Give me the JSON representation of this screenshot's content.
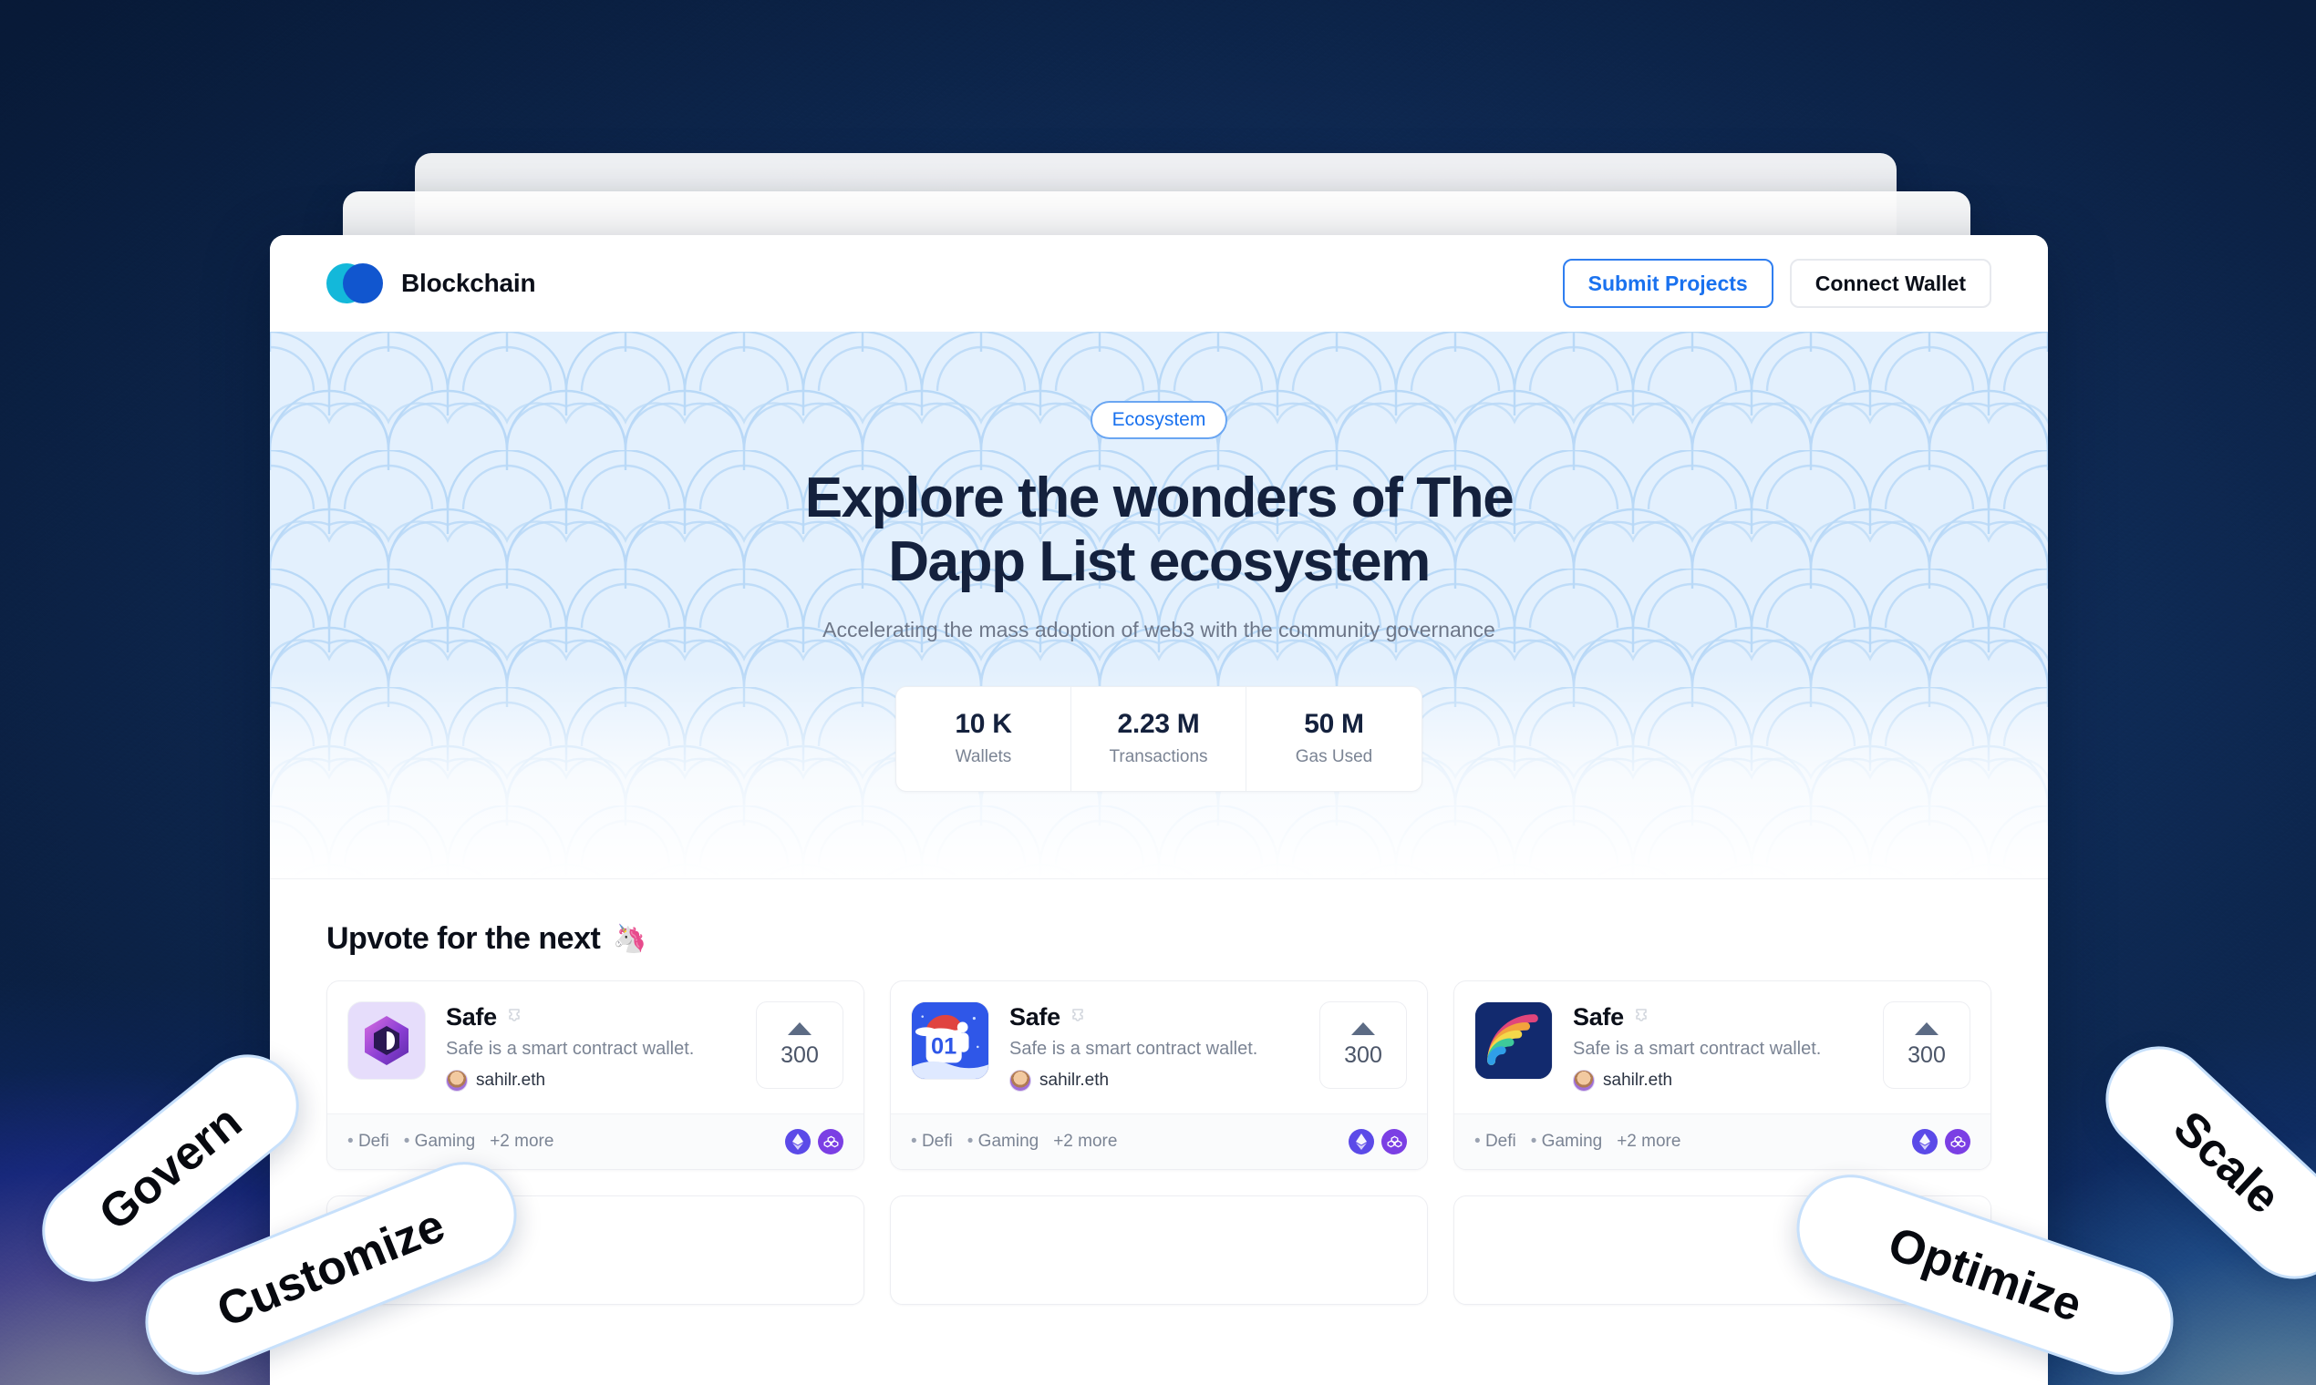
{
  "header": {
    "brand_name": "Blockchain",
    "logo_colors": {
      "left": "#13b8da",
      "right": "#1156cf"
    },
    "submit_label": "Submit Projects",
    "wallet_label": "Connect Wallet"
  },
  "hero": {
    "badge": "Ecosystem",
    "title_line1": "Explore the wonders of The",
    "title_line2": "Dapp List ecosystem",
    "subtitle": "Accelerating the mass adoption of web3 with the  community governance",
    "stats": [
      {
        "value": "10 K",
        "label": "Wallets"
      },
      {
        "value": "2.23 M",
        "label": "Transactions"
      },
      {
        "value": "50 M",
        "label": "Gas Used"
      }
    ]
  },
  "upvote": {
    "heading": "Upvote for the next",
    "emoji": "🦄",
    "cards": [
      {
        "name": "Safe",
        "verified_icon": "puzzle-piece-icon",
        "description": "Safe is a smart contract wallet.",
        "owner": "sahilr.eth",
        "upvotes": "300",
        "tags": [
          "Defi",
          "Gaming"
        ],
        "more_tags": "+2 more",
        "logo": "safe-hexagon-logo",
        "chains": [
          "ethereum-icon",
          "polygon-icon"
        ]
      },
      {
        "name": "Safe",
        "verified_icon": "puzzle-piece-icon",
        "description": "Safe is a smart contract wallet.",
        "owner": "sahilr.eth",
        "upvotes": "300",
        "tags": [
          "Defi",
          "Gaming"
        ],
        "more_tags": "+2 more",
        "logo": "calendar-01-santa-logo",
        "chains": [
          "ethereum-icon",
          "polygon-icon"
        ]
      },
      {
        "name": "Safe",
        "verified_icon": "puzzle-piece-icon",
        "description": "Safe is a smart contract wallet.",
        "owner": "sahilr.eth",
        "upvotes": "300",
        "tags": [
          "Defi",
          "Gaming"
        ],
        "more_tags": "+2 more",
        "logo": "rainbow-logo",
        "chains": [
          "ethereum-icon",
          "polygon-icon"
        ]
      }
    ]
  },
  "floating_pills": [
    {
      "label": "Govern"
    },
    {
      "label": "Customize"
    },
    {
      "label": "Optimize"
    },
    {
      "label": "Scale"
    }
  ],
  "colors": {
    "accent_blue": "#1a72ef",
    "hero_bg": "#e3f0fd",
    "hero_pattern_line": "#b9d9f7",
    "heading_navy": "#14213d",
    "pill_border": "#c7e0fb",
    "backdrop_navy": "#0e2a52"
  }
}
